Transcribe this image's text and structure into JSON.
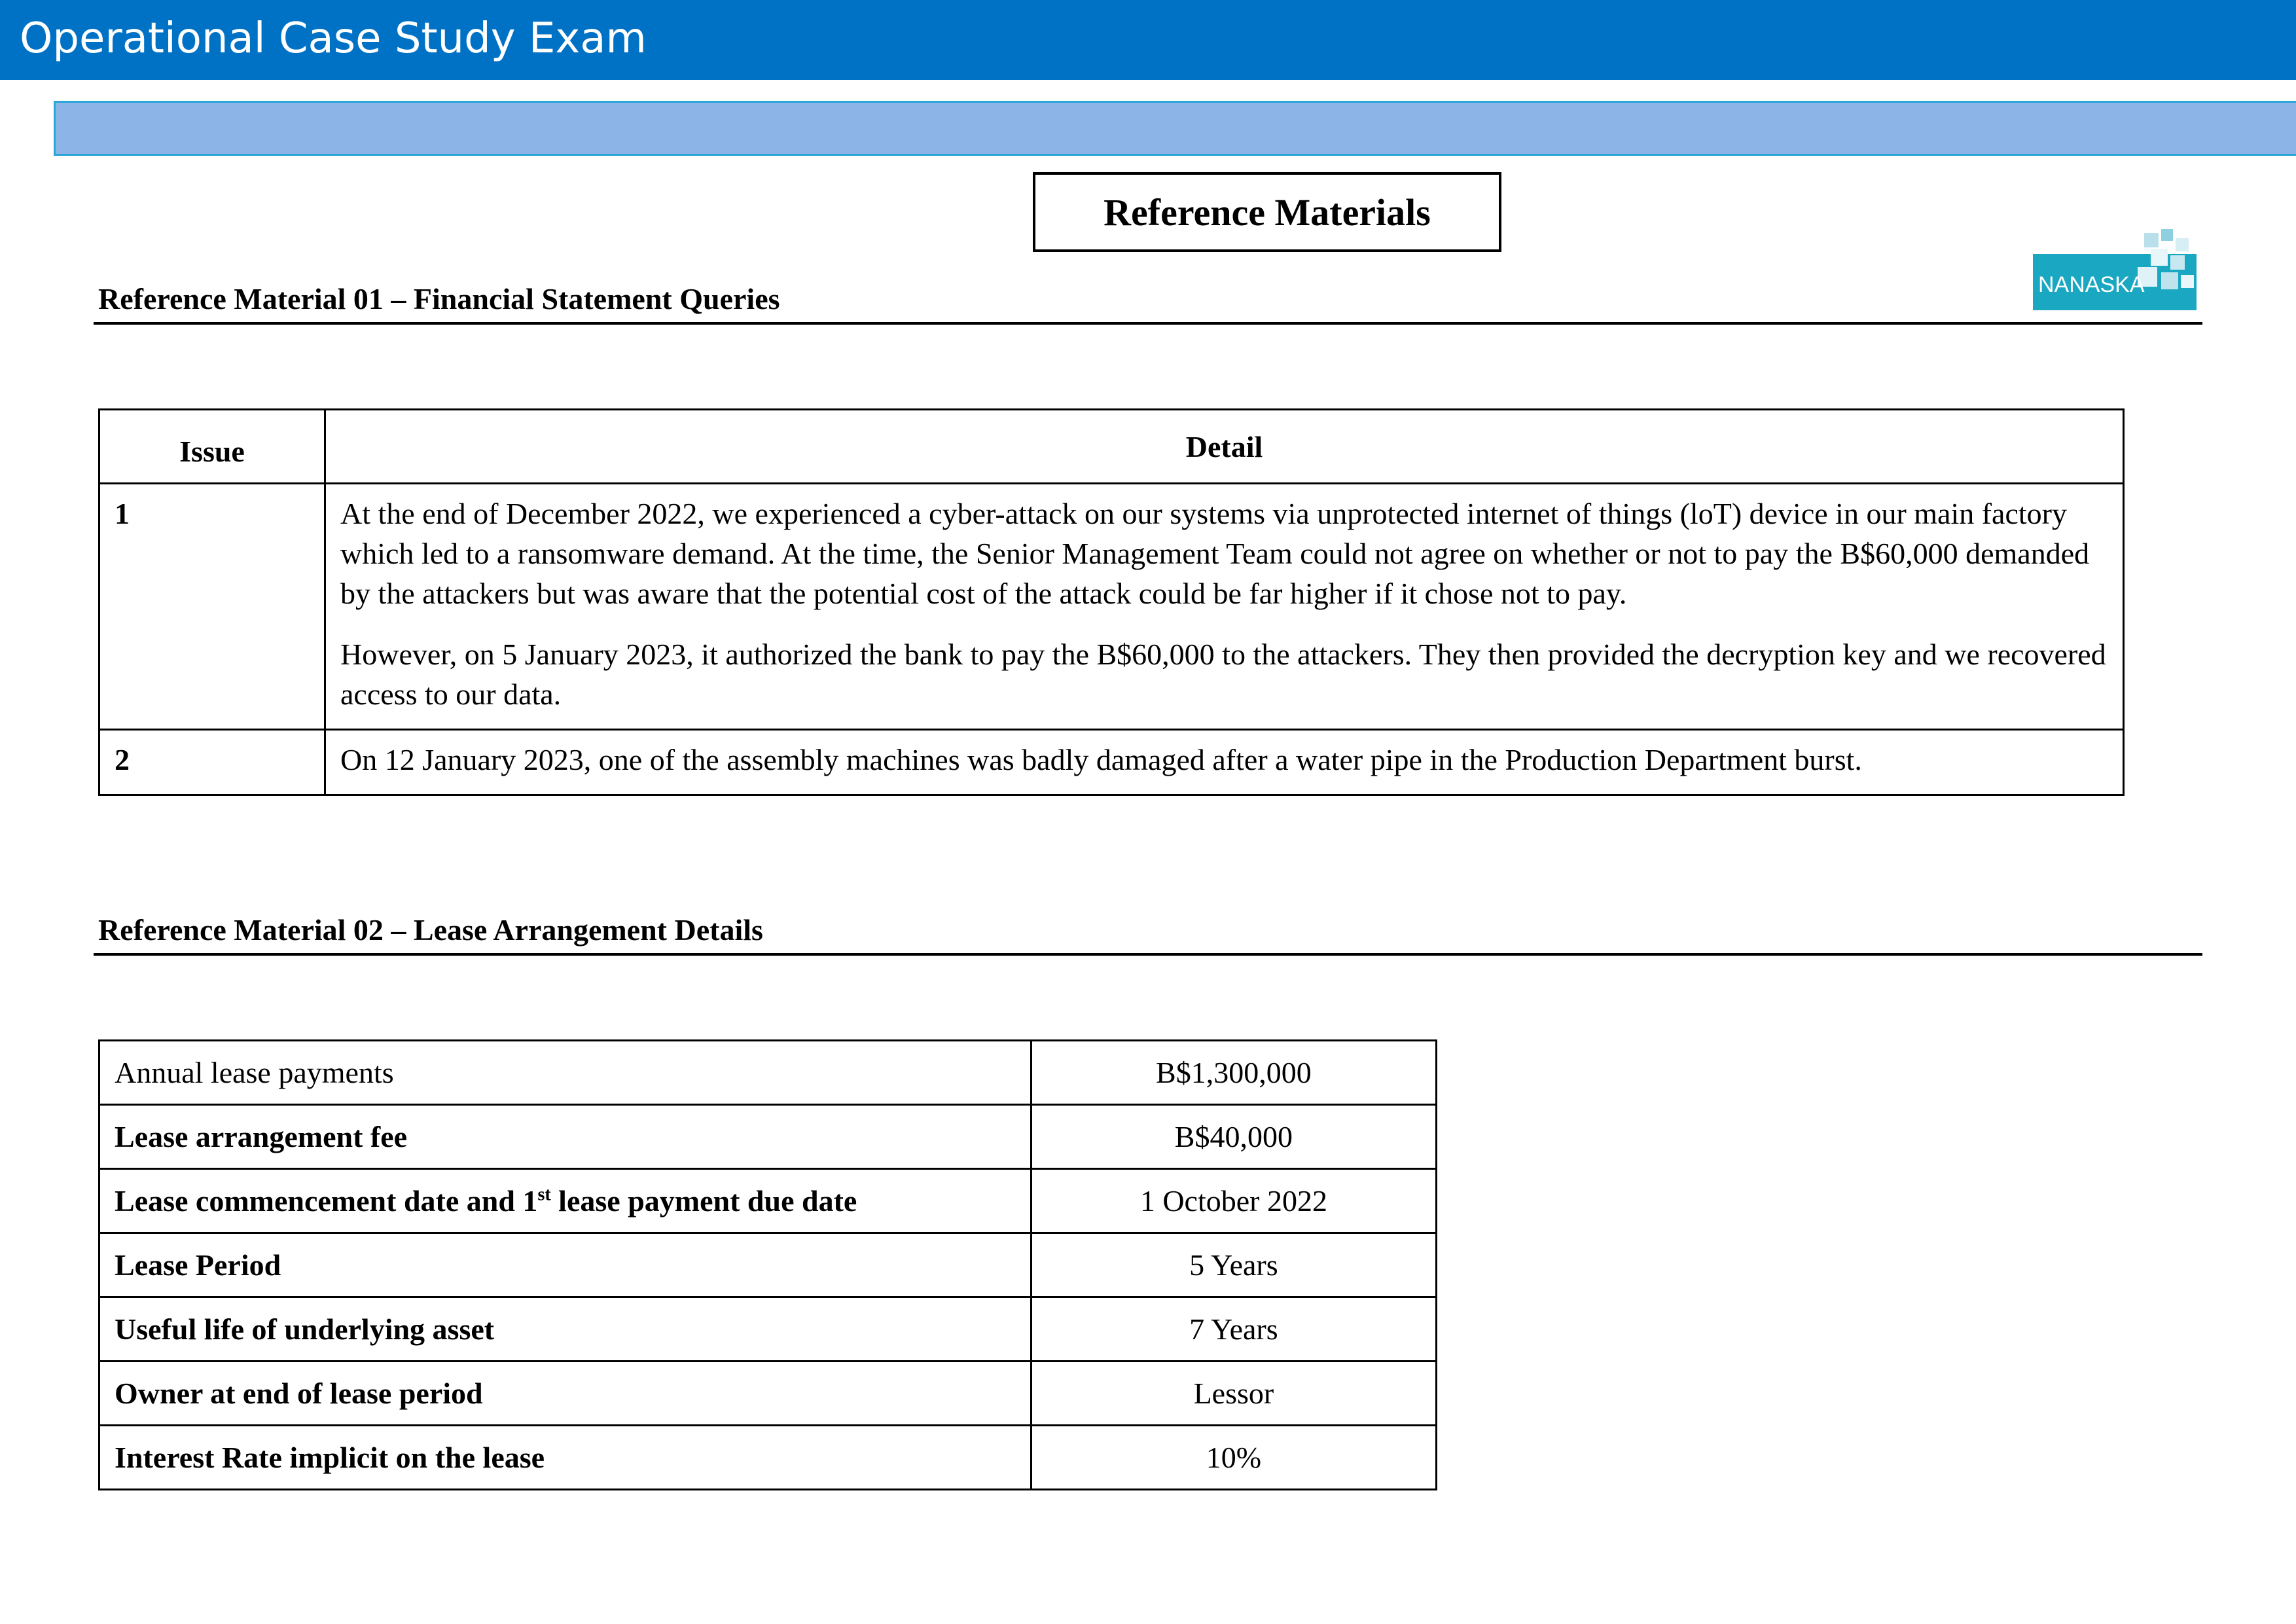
{
  "header": {
    "title": "Operational Case Study Exam"
  },
  "page_title": "Reference Materials",
  "logo": {
    "text": "NANASKA"
  },
  "section1": {
    "heading": "Reference Material 01 – Financial Statement Queries",
    "columns": [
      "Issue",
      "Detail"
    ],
    "rows": [
      {
        "issue": "1",
        "paragraphs": [
          "At the end of December 2022, we experienced a cyber-attack on our systems via unprotected internet of things (loT) device in our main factory which led to a ransomware demand. At the time, the Senior Management Team could not agree on whether or not to pay the B$60,000 demanded by the attackers but was aware that the potential cost of the attack could be far higher if it chose not to pay.",
          "However, on 5 January 2023, it authorized the bank to pay the B$60,000 to the attackers. They then provided the decryption key and we recovered access to our data."
        ]
      },
      {
        "issue": "2",
        "paragraphs": [
          "On 12 January 2023, one of the assembly machines was badly damaged after a water pipe in the Production Department burst."
        ]
      }
    ]
  },
  "section2": {
    "heading": "Reference Material 02 – Lease Arrangement Details",
    "rows": [
      {
        "label": "Annual lease payments",
        "value": "B$1,300,000"
      },
      {
        "label": "Lease arrangement fee",
        "value": "B$40,000"
      },
      {
        "label_pre": "Lease commencement date and 1",
        "label_sup": "st",
        "label_post": " lease payment due date",
        "value": "1 October 2022"
      },
      {
        "label": "Lease Period",
        "value": "5 Years"
      },
      {
        "label": "Useful life of underlying asset",
        "value": "7 Years"
      },
      {
        "label": "Owner at end of lease period",
        "value": "Lessor"
      },
      {
        "label": "Interest Rate implicit on the lease",
        "value": "10%"
      }
    ]
  }
}
